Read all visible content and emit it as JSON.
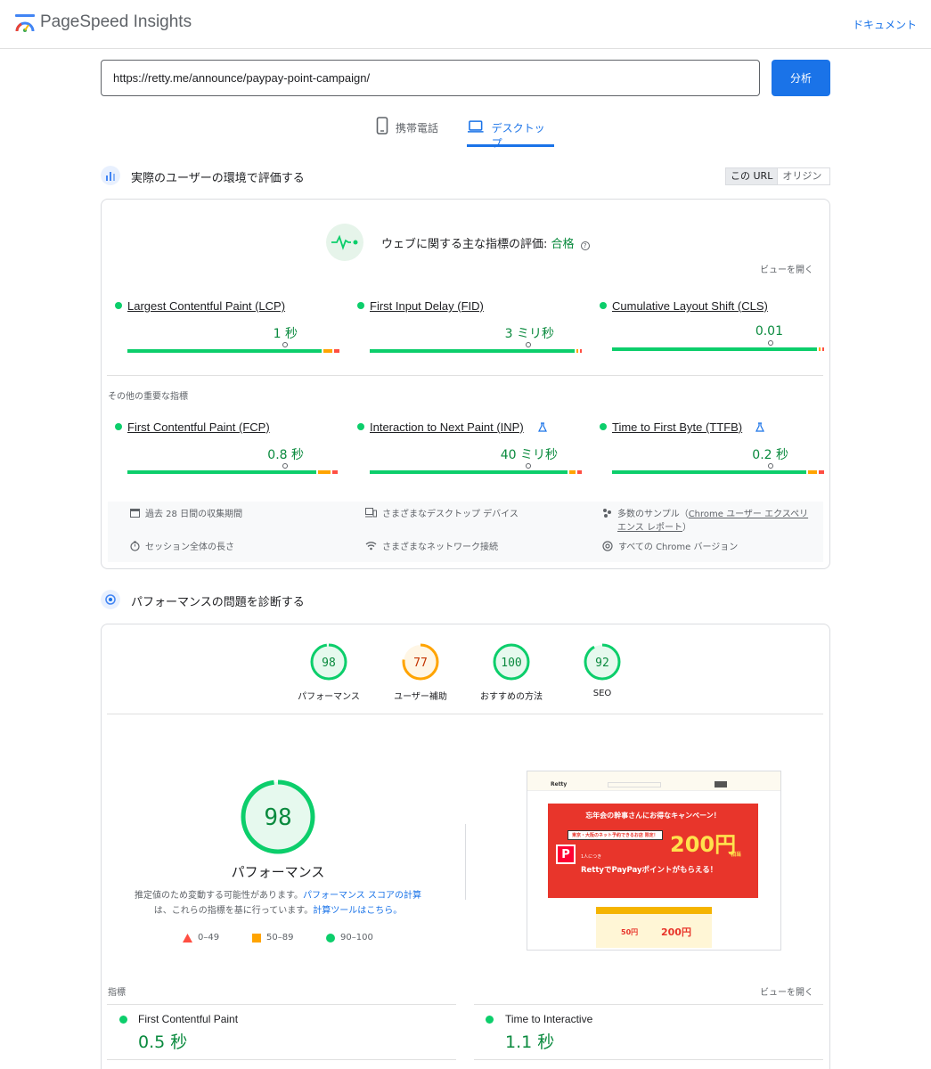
{
  "header": {
    "title": "PageSpeed Insights",
    "docs_label": "ドキュメント"
  },
  "url_bar": {
    "value": "https://retty.me/announce/paypay-point-campaign/",
    "analyze_label": "分析"
  },
  "tabs": [
    {
      "label": "携帯電話",
      "active": false
    },
    {
      "label": "デスクトップ",
      "active": true
    }
  ],
  "field": {
    "title": "実際のユーザーの環境で評価する",
    "toggle": {
      "this_url": "この URL",
      "origin": "オリジン"
    },
    "assessment_prefix": "ウェブに関する主な指標の評価: ",
    "assessment_result": "合格",
    "expand_label": "ビューを開く",
    "core_metrics": [
      {
        "name": "Largest Contentful Paint (LCP)",
        "value": "1 秒",
        "pos": 0.65
      },
      {
        "name": "First Input Delay (FID)",
        "value": "3 ミリ秒",
        "pos": 0.76
      },
      {
        "name": "Cumulative Layout Shift (CLS)",
        "value": "0.01",
        "pos": 0.74
      }
    ],
    "other_label": "その他の重要な指標",
    "other_metrics": [
      {
        "name": "First Contentful Paint (FCP)",
        "value": "0.8 秒",
        "pos": 0.73
      },
      {
        "name": "Interaction to Next Paint (INP)",
        "value": "40 ミリ秒",
        "pos": 0.76
      },
      {
        "name": "Time to First Byte (TTFB)",
        "value": "0.2 秒",
        "pos": 0.67
      }
    ],
    "info": {
      "period": "過去 28 日間の収集期間",
      "devices": "さまざまなデスクトップ デバイス",
      "samples_prefix": "多数のサンプル（",
      "samples_link_1": "Chrome ユーザー エクスペリ",
      "samples_link_2": "エンス レポート",
      "samples_suffix": "）",
      "session": "セッション全体の長さ",
      "network": "さまざまなネットワーク接続",
      "versions": "すべての Chrome バージョン"
    }
  },
  "diagnose": {
    "title": "パフォーマンスの問題を診断する",
    "scores": [
      {
        "value": "98",
        "score": 98,
        "label": "パフォーマンス",
        "color": "#0cce6b",
        "text": "#0a8a3e"
      },
      {
        "value": "77",
        "score": 77,
        "label": "ユーザー補助",
        "color": "#ffa400",
        "text": "#c33300"
      },
      {
        "value": "100",
        "score": 100,
        "label": "おすすめの方法",
        "color": "#0cce6b",
        "text": "#0a8a3e"
      },
      {
        "value": "92",
        "score": 92,
        "label": "SEO",
        "color": "#0cce6b",
        "text": "#0a8a3e"
      }
    ],
    "big_score": {
      "value": "98",
      "score": 98,
      "label": "パフォーマンス"
    },
    "note_1": "推定値のため変動する可能性があります。",
    "note_link_1": "パフォーマンス スコアの計算",
    "note_2": "は、これらの指標を基に行っています。",
    "note_link_2": "計算ツールはこちら。",
    "legend": {
      "bad": "0–49",
      "average": "50–89",
      "good": "90–100"
    },
    "metrics_label": "指標",
    "expand_label": "ビューを開く",
    "lab_metrics": [
      {
        "name": "First Contentful Paint",
        "value": "0.5 秒"
      },
      {
        "name": "Time to Interactive",
        "value": "1.1 秒"
      }
    ],
    "screenshot": {
      "brand": "Retty",
      "headline": "忘年会の幹事さんにお得なキャンペーン！",
      "tag": "東京・大阪のネット予約できるお店 限定！",
      "big_amount": "200円",
      "amount_sub": "相当",
      "pay_line": "RettyでPayPayポイントがもらえる！",
      "mid_amount": "50円",
      "per_person": "1人につき"
    }
  },
  "colors": {
    "accent": "#1a73e8",
    "good": "#0cce6b",
    "average": "#ffa400",
    "bad": "#ff4e42"
  }
}
